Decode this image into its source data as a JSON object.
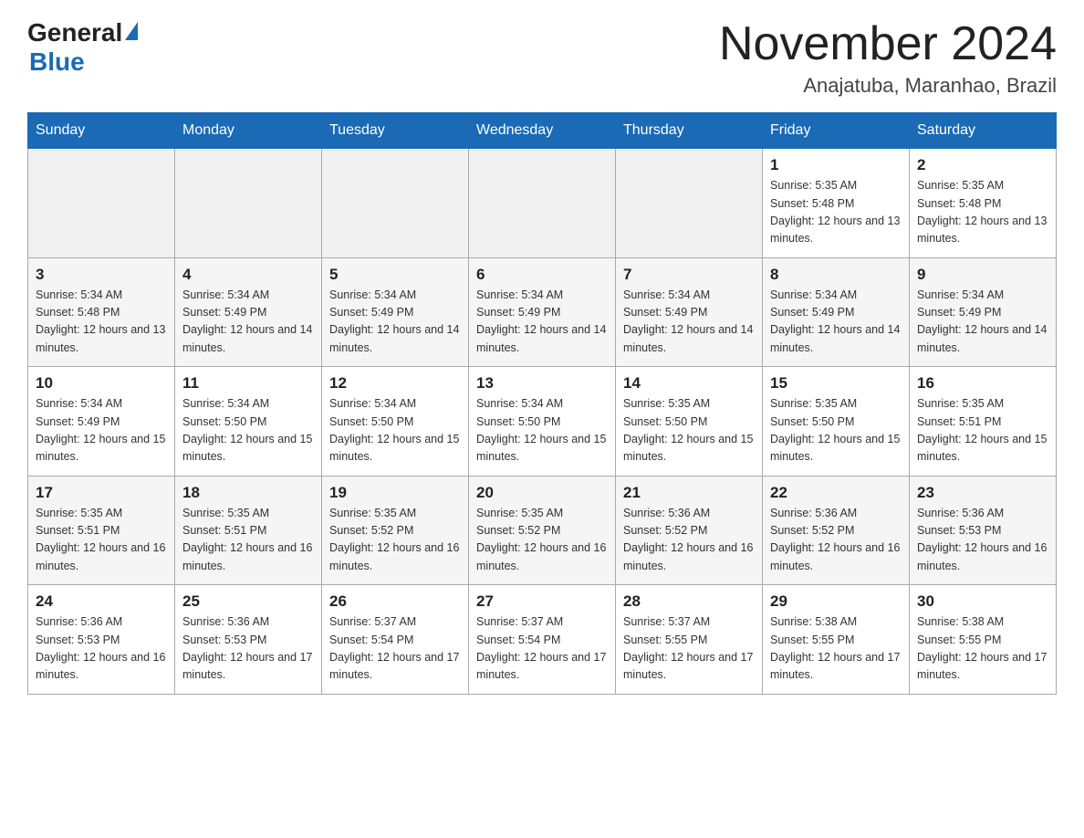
{
  "logo": {
    "text_general": "General",
    "text_blue": "Blue"
  },
  "header": {
    "title": "November 2024",
    "location": "Anajatuba, Maranhao, Brazil"
  },
  "weekdays": [
    "Sunday",
    "Monday",
    "Tuesday",
    "Wednesday",
    "Thursday",
    "Friday",
    "Saturday"
  ],
  "weeks": [
    [
      {
        "day": "",
        "sunrise": "",
        "sunset": "",
        "daylight": ""
      },
      {
        "day": "",
        "sunrise": "",
        "sunset": "",
        "daylight": ""
      },
      {
        "day": "",
        "sunrise": "",
        "sunset": "",
        "daylight": ""
      },
      {
        "day": "",
        "sunrise": "",
        "sunset": "",
        "daylight": ""
      },
      {
        "day": "",
        "sunrise": "",
        "sunset": "",
        "daylight": ""
      },
      {
        "day": "1",
        "sunrise": "Sunrise: 5:35 AM",
        "sunset": "Sunset: 5:48 PM",
        "daylight": "Daylight: 12 hours and 13 minutes."
      },
      {
        "day": "2",
        "sunrise": "Sunrise: 5:35 AM",
        "sunset": "Sunset: 5:48 PM",
        "daylight": "Daylight: 12 hours and 13 minutes."
      }
    ],
    [
      {
        "day": "3",
        "sunrise": "Sunrise: 5:34 AM",
        "sunset": "Sunset: 5:48 PM",
        "daylight": "Daylight: 12 hours and 13 minutes."
      },
      {
        "day": "4",
        "sunrise": "Sunrise: 5:34 AM",
        "sunset": "Sunset: 5:49 PM",
        "daylight": "Daylight: 12 hours and 14 minutes."
      },
      {
        "day": "5",
        "sunrise": "Sunrise: 5:34 AM",
        "sunset": "Sunset: 5:49 PM",
        "daylight": "Daylight: 12 hours and 14 minutes."
      },
      {
        "day": "6",
        "sunrise": "Sunrise: 5:34 AM",
        "sunset": "Sunset: 5:49 PM",
        "daylight": "Daylight: 12 hours and 14 minutes."
      },
      {
        "day": "7",
        "sunrise": "Sunrise: 5:34 AM",
        "sunset": "Sunset: 5:49 PM",
        "daylight": "Daylight: 12 hours and 14 minutes."
      },
      {
        "day": "8",
        "sunrise": "Sunrise: 5:34 AM",
        "sunset": "Sunset: 5:49 PM",
        "daylight": "Daylight: 12 hours and 14 minutes."
      },
      {
        "day": "9",
        "sunrise": "Sunrise: 5:34 AM",
        "sunset": "Sunset: 5:49 PM",
        "daylight": "Daylight: 12 hours and 14 minutes."
      }
    ],
    [
      {
        "day": "10",
        "sunrise": "Sunrise: 5:34 AM",
        "sunset": "Sunset: 5:49 PM",
        "daylight": "Daylight: 12 hours and 15 minutes."
      },
      {
        "day": "11",
        "sunrise": "Sunrise: 5:34 AM",
        "sunset": "Sunset: 5:50 PM",
        "daylight": "Daylight: 12 hours and 15 minutes."
      },
      {
        "day": "12",
        "sunrise": "Sunrise: 5:34 AM",
        "sunset": "Sunset: 5:50 PM",
        "daylight": "Daylight: 12 hours and 15 minutes."
      },
      {
        "day": "13",
        "sunrise": "Sunrise: 5:34 AM",
        "sunset": "Sunset: 5:50 PM",
        "daylight": "Daylight: 12 hours and 15 minutes."
      },
      {
        "day": "14",
        "sunrise": "Sunrise: 5:35 AM",
        "sunset": "Sunset: 5:50 PM",
        "daylight": "Daylight: 12 hours and 15 minutes."
      },
      {
        "day": "15",
        "sunrise": "Sunrise: 5:35 AM",
        "sunset": "Sunset: 5:50 PM",
        "daylight": "Daylight: 12 hours and 15 minutes."
      },
      {
        "day": "16",
        "sunrise": "Sunrise: 5:35 AM",
        "sunset": "Sunset: 5:51 PM",
        "daylight": "Daylight: 12 hours and 15 minutes."
      }
    ],
    [
      {
        "day": "17",
        "sunrise": "Sunrise: 5:35 AM",
        "sunset": "Sunset: 5:51 PM",
        "daylight": "Daylight: 12 hours and 16 minutes."
      },
      {
        "day": "18",
        "sunrise": "Sunrise: 5:35 AM",
        "sunset": "Sunset: 5:51 PM",
        "daylight": "Daylight: 12 hours and 16 minutes."
      },
      {
        "day": "19",
        "sunrise": "Sunrise: 5:35 AM",
        "sunset": "Sunset: 5:52 PM",
        "daylight": "Daylight: 12 hours and 16 minutes."
      },
      {
        "day": "20",
        "sunrise": "Sunrise: 5:35 AM",
        "sunset": "Sunset: 5:52 PM",
        "daylight": "Daylight: 12 hours and 16 minutes."
      },
      {
        "day": "21",
        "sunrise": "Sunrise: 5:36 AM",
        "sunset": "Sunset: 5:52 PM",
        "daylight": "Daylight: 12 hours and 16 minutes."
      },
      {
        "day": "22",
        "sunrise": "Sunrise: 5:36 AM",
        "sunset": "Sunset: 5:52 PM",
        "daylight": "Daylight: 12 hours and 16 minutes."
      },
      {
        "day": "23",
        "sunrise": "Sunrise: 5:36 AM",
        "sunset": "Sunset: 5:53 PM",
        "daylight": "Daylight: 12 hours and 16 minutes."
      }
    ],
    [
      {
        "day": "24",
        "sunrise": "Sunrise: 5:36 AM",
        "sunset": "Sunset: 5:53 PM",
        "daylight": "Daylight: 12 hours and 16 minutes."
      },
      {
        "day": "25",
        "sunrise": "Sunrise: 5:36 AM",
        "sunset": "Sunset: 5:53 PM",
        "daylight": "Daylight: 12 hours and 17 minutes."
      },
      {
        "day": "26",
        "sunrise": "Sunrise: 5:37 AM",
        "sunset": "Sunset: 5:54 PM",
        "daylight": "Daylight: 12 hours and 17 minutes."
      },
      {
        "day": "27",
        "sunrise": "Sunrise: 5:37 AM",
        "sunset": "Sunset: 5:54 PM",
        "daylight": "Daylight: 12 hours and 17 minutes."
      },
      {
        "day": "28",
        "sunrise": "Sunrise: 5:37 AM",
        "sunset": "Sunset: 5:55 PM",
        "daylight": "Daylight: 12 hours and 17 minutes."
      },
      {
        "day": "29",
        "sunrise": "Sunrise: 5:38 AM",
        "sunset": "Sunset: 5:55 PM",
        "daylight": "Daylight: 12 hours and 17 minutes."
      },
      {
        "day": "30",
        "sunrise": "Sunrise: 5:38 AM",
        "sunset": "Sunset: 5:55 PM",
        "daylight": "Daylight: 12 hours and 17 minutes."
      }
    ]
  ]
}
